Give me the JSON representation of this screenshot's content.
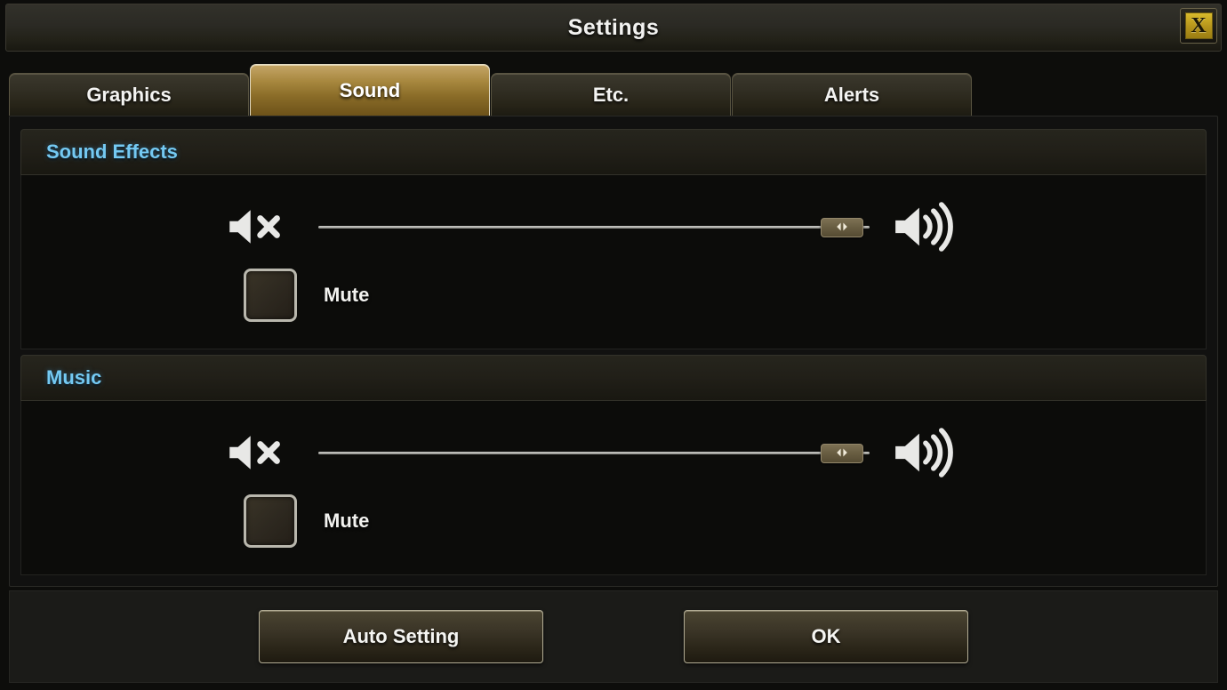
{
  "window": {
    "title": "Settings",
    "close_icon": "close-x-icon",
    "close_label": "X"
  },
  "tabs": [
    {
      "label": "Graphics",
      "active": false
    },
    {
      "label": "Sound",
      "active": true
    },
    {
      "label": "Etc.",
      "active": false
    },
    {
      "label": "Alerts",
      "active": false
    }
  ],
  "sections": [
    {
      "title": "Sound Effects",
      "slider": {
        "min_icon": "speaker-mute-icon",
        "max_icon": "speaker-volume-high-icon",
        "handle_icon": "left-right-arrows-icon",
        "handle_glyph": "◀▶",
        "value_percent": 95
      },
      "mute": {
        "label": "Mute",
        "checked": false
      }
    },
    {
      "title": "Music",
      "slider": {
        "min_icon": "speaker-mute-icon",
        "max_icon": "speaker-volume-high-icon",
        "handle_icon": "left-right-arrows-icon",
        "handle_glyph": "◀▶",
        "value_percent": 95
      },
      "mute": {
        "label": "Mute",
        "checked": false
      }
    }
  ],
  "footer": {
    "auto_setting_label": "Auto Setting",
    "ok_label": "OK"
  },
  "colors": {
    "accent_blue": "#74c9f2",
    "tab_active_gold": "#a8883f",
    "close_gold": "#b8971c",
    "text": "#f2f2f0",
    "background": "#0d0d0b"
  }
}
